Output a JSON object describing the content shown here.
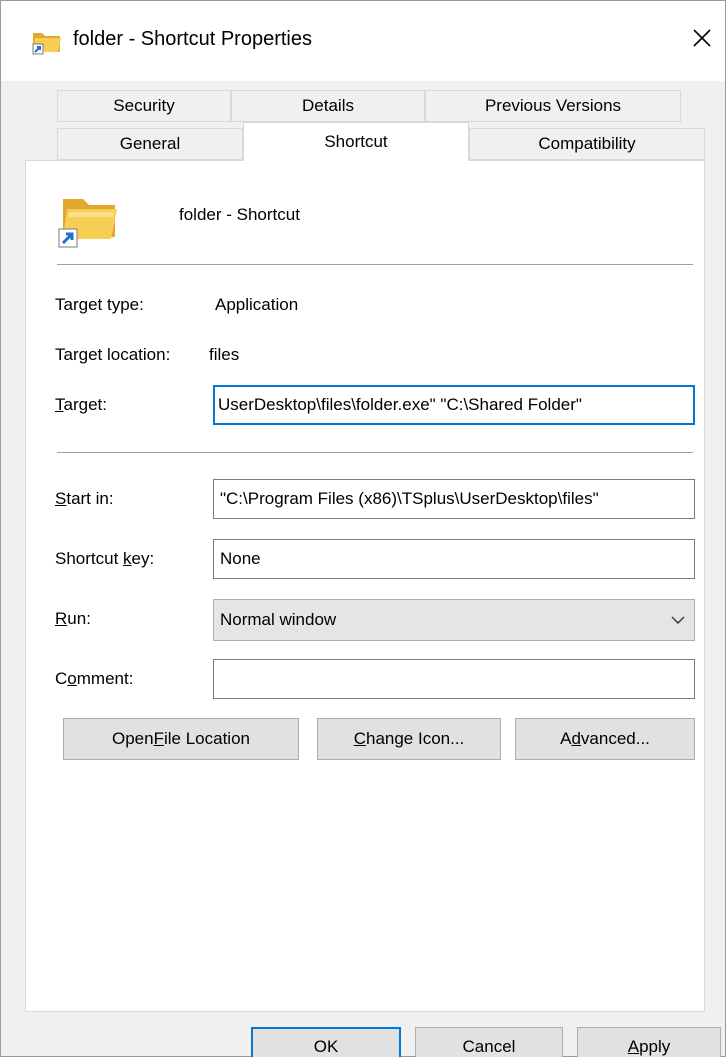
{
  "window": {
    "title": "folder - Shortcut Properties",
    "icon": "folder-shortcut-icon",
    "close_icon": "close-icon"
  },
  "tabs": {
    "row1": [
      "Security",
      "Details",
      "Previous Versions"
    ],
    "row2": [
      "General",
      "Shortcut",
      "Compatibility"
    ],
    "active": "Shortcut"
  },
  "header": {
    "shortcut_name": "folder - Shortcut"
  },
  "info": {
    "target_type_label": "Target type:",
    "target_type_value": "Application",
    "target_location_label": "Target location:",
    "target_location_value": "files"
  },
  "fields": {
    "target_label": "Target:",
    "target_value": "UserDesktop\\files\\folder.exe\" \"C:\\Shared Folder\"",
    "start_in_label": "Start in:",
    "start_in_value": "\"C:\\Program Files (x86)\\TSplus\\UserDesktop\\files\"",
    "shortcut_key_label": "Shortcut key:",
    "shortcut_key_value": "None",
    "run_label": "Run:",
    "run_value": "Normal window",
    "comment_label": "Comment:",
    "comment_value": ""
  },
  "actions": {
    "open_file_location": "Open File Location",
    "change_icon": "Change Icon...",
    "advanced": "Advanced..."
  },
  "footer": {
    "ok": "OK",
    "cancel": "Cancel",
    "apply": "Apply"
  },
  "colors": {
    "accent": "#0078d7",
    "folder_yellow": "#f4c542",
    "shortcut_arrow": "#1e6fd0"
  }
}
